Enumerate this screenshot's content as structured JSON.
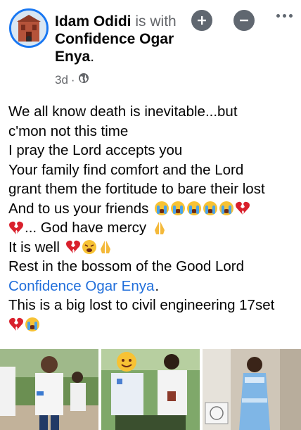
{
  "header": {
    "author": "Idam Odidi",
    "with_text": "is with",
    "tagged_name_1": "Confidence Ogar",
    "tagged_name_2": "Enya",
    "period": ".",
    "time": "3d",
    "separator": "·",
    "privacy_icon": "globe-icon",
    "add_icon": "plus-icon",
    "remove_icon": "minus-icon",
    "more_icon": "more-dots-icon"
  },
  "post": {
    "line1": "We all know death is inevitable...but",
    "line2": "c'mon not this time",
    "line3": "I pray the Lord accepts you",
    "line4": "Your family find comfort and the Lord",
    "line5": "grant them the fortitude to bare their lost",
    "line6": "And to us your friends",
    "line7": "... God have mercy",
    "line8": "It is well",
    "line9": "Rest in the bossom of the Good Lord",
    "line10_link": "Confidence Ogar Enya",
    "line10_end": ".",
    "line11": "This is a big lost to civil engineering 17set"
  },
  "colors": {
    "accent": "#1877f2",
    "link": "#216fdb",
    "muted": "#65676b",
    "icon": "#606770"
  },
  "photos": [
    "photo-group-students",
    "photo-friends-selfie",
    "photo-woman-blue-dress"
  ]
}
